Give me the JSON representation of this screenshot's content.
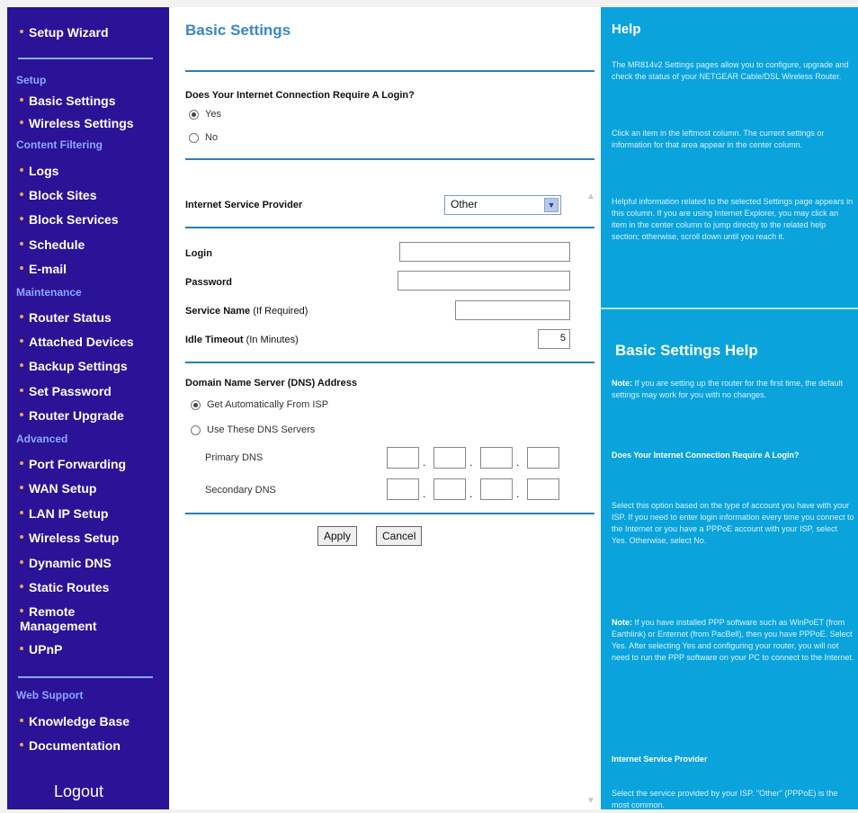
{
  "nav": {
    "setup_wizard": "Setup Wizard",
    "section_setup": "Setup",
    "basic_settings": "Basic Settings",
    "wireless_settings": "Wireless Settings",
    "section_content_filtering": "Content Filtering",
    "logs": "Logs",
    "block_sites": "Block Sites",
    "block_services": "Block Services",
    "schedule": "Schedule",
    "email": "E-mail",
    "section_maintenance": "Maintenance",
    "router_status": "Router Status",
    "attached_devices": "Attached Devices",
    "backup_settings": "Backup Settings",
    "set_password": "Set Password",
    "router_upgrade": "Router Upgrade",
    "section_advanced": "Advanced",
    "port_forwarding": "Port Forwarding",
    "wan_setup": "WAN Setup",
    "lan_ip_setup": "LAN IP Setup",
    "wireless_setup": "Wireless Setup",
    "dynamic_dns": "Dynamic DNS",
    "static_routes": "Static Routes",
    "remote_management_1": "Remote",
    "remote_management_2": "Management",
    "upnp": "UPnP",
    "section_web_support": "Web Support",
    "knowledge_base": "Knowledge Base",
    "documentation": "Documentation",
    "logout": "Logout"
  },
  "main": {
    "title": "Basic Settings",
    "login_question": "Does Your Internet Connection Require A Login?",
    "yes": "Yes",
    "no": "No",
    "isp_label": "Internet Service Provider",
    "isp_value": "Other",
    "login_label": "Login",
    "password_label": "Password",
    "service_name_label": "Service Name",
    "service_name_hint": "(If Required)",
    "idle_timeout_label": "Idle Timeout",
    "idle_timeout_hint": "(In Minutes)",
    "idle_timeout_value": "5",
    "dns_heading": "Domain Name Server (DNS) Address",
    "dns_auto": "Get Automatically From ISP",
    "dns_manual": "Use These DNS Servers",
    "primary_dns": "Primary DNS",
    "secondary_dns": "Secondary DNS",
    "apply": "Apply",
    "cancel": "Cancel"
  },
  "help": {
    "title": "Help",
    "p1": "The MR814v2 Settings pages allow you to configure, upgrade and check the status of your NETGEAR Cable/DSL Wireless Router.",
    "p2": "Click an item in the leftmost column. The current settings or information for that area appear in the center column.",
    "p3": "Helpful information related to the selected Settings page appears in this column. If you are using Internet Explorer, you may click an item in the center column to jump directly to the related help section; otherwise, scroll down until you reach it.",
    "subtitle": "Basic Settings Help",
    "note1_label": "Note:",
    "note1": "If you are setting up the router for the first time, the default settings may work for you with no changes.",
    "q_heading": "Does Your Internet Connection Require A Login?",
    "p4": "Select this option based on the type of account you have with your ISP. If you need to enter login information every time you connect to the Internet or you have a PPPoE account with your ISP, select Yes. Otherwise, select No.",
    "note2_label": "Note:",
    "note2": "If you have installed PPP software such as WinPoET (from Earthlink) or Enternet (from PacBell), then you have PPPoE. Select Yes. After selecting Yes and configuring your router, you will not need to run the PPP software on your PC to connect to the Internet.",
    "isp_heading": "Internet Service Provider",
    "p5": "Select the service provided by your ISP. \"Other\" (PPPoE) is the most common."
  },
  "colors": {
    "nav_bg": "#2a1396",
    "nav_section": "#8fa6ff",
    "help_bg": "#0aa3dc",
    "title_blue": "#3a86c8",
    "rule_blue": "#2a7fb5"
  }
}
